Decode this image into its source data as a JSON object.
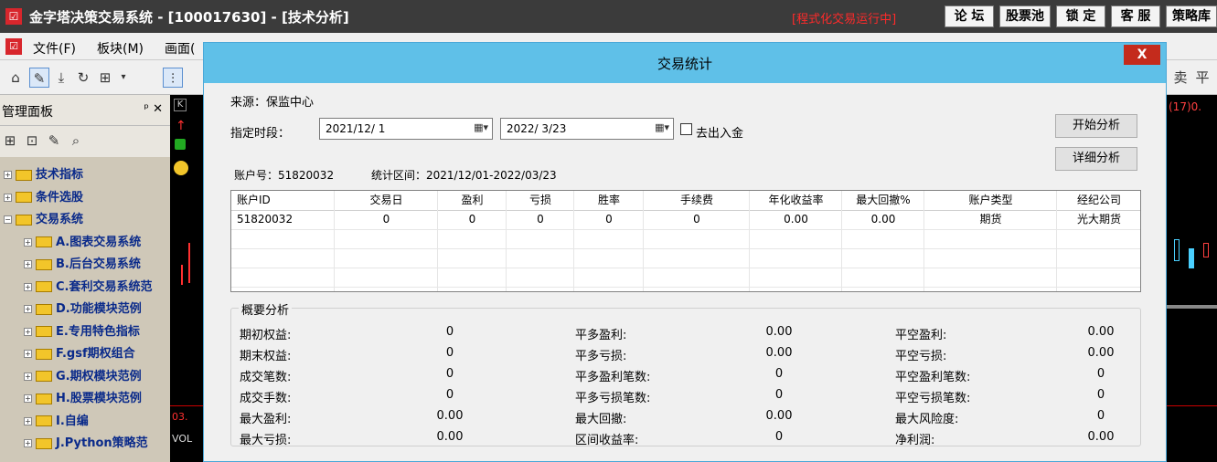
{
  "app": {
    "title": "金字塔决策交易系统 - [100017630] - [技术分析]",
    "run_status": "[程式化交易运行中]",
    "top_buttons": [
      "论 坛",
      "股票池",
      "锁 定",
      "客 服",
      "策略库"
    ]
  },
  "menu": {
    "items": [
      "文件(F)",
      "板块(M)",
      "画面("
    ]
  },
  "right_strip": {
    "labels": [
      "卖",
      "平"
    ],
    "value_text": "(17)0."
  },
  "chart_strip": {
    "label_k": "K",
    "label_date": "03.",
    "label_vol": "VOL"
  },
  "panel": {
    "title": "管理面板",
    "pin": "ᵖ ✕",
    "tree": [
      {
        "label": "技术指标",
        "level": 0,
        "expanded": false
      },
      {
        "label": "条件选股",
        "level": 0,
        "expanded": false
      },
      {
        "label": "交易系统",
        "level": 0,
        "expanded": true
      },
      {
        "label": "A.图表交易系统",
        "level": 1,
        "expanded": false
      },
      {
        "label": "B.后台交易系统",
        "level": 1,
        "expanded": false
      },
      {
        "label": "C.套利交易系统范",
        "level": 1,
        "expanded": false
      },
      {
        "label": "D.功能模块范例",
        "level": 1,
        "expanded": false
      },
      {
        "label": "E.专用特色指标",
        "level": 1,
        "expanded": false
      },
      {
        "label": "F.gsf期权组合",
        "level": 1,
        "expanded": false
      },
      {
        "label": "G.期权模块范例",
        "level": 1,
        "expanded": false
      },
      {
        "label": "H.股票模块范例",
        "level": 1,
        "expanded": false
      },
      {
        "label": "I.自编",
        "level": 1,
        "expanded": false
      },
      {
        "label": "J.Python策略范",
        "level": 1,
        "expanded": false
      }
    ]
  },
  "dialog": {
    "title": "交易统计",
    "close": "X",
    "source_label": "来源：保监中心",
    "period_label": "指定时段：",
    "start_date": "2021/12/ 1",
    "end_date": "2022/ 3/23",
    "exclude_label": "去出入金",
    "exclude_checked": false,
    "start_button": "开始分析",
    "detail_button": "详细分析",
    "account_label": "账户号：51820032",
    "range_label": "统计区间：2021/12/01-2022/03/23",
    "table": {
      "headers": [
        "账户ID",
        "交易日",
        "盈利",
        "亏损",
        "胜率",
        "手续费",
        "年化收益率",
        "最大回撤%",
        "账户类型",
        "经纪公司"
      ],
      "rows": [
        [
          "51820032",
          "0",
          "0",
          "0",
          "0",
          "0",
          "0.00",
          "0.00",
          "期货",
          "光大期货"
        ]
      ]
    },
    "summary": {
      "title": "概要分析",
      "col1": [
        {
          "label": "期初权益:",
          "value": "0"
        },
        {
          "label": "期末权益:",
          "value": "0"
        },
        {
          "label": "成交笔数:",
          "value": "0"
        },
        {
          "label": "成交手数:",
          "value": "0"
        },
        {
          "label": "最大盈利:",
          "value": "0.00"
        },
        {
          "label": "最大亏损:",
          "value": "0.00"
        }
      ],
      "col2": [
        {
          "label": "平多盈利:",
          "value": "0.00"
        },
        {
          "label": "平多亏损:",
          "value": "0.00"
        },
        {
          "label": "平多盈利笔数:",
          "value": "0"
        },
        {
          "label": "平多亏损笔数:",
          "value": "0"
        },
        {
          "label": "最大回撤:",
          "value": "0.00"
        },
        {
          "label": "区间收益率:",
          "value": "0"
        }
      ],
      "col3": [
        {
          "label": "平空盈利:",
          "value": "0.00"
        },
        {
          "label": "平空亏损:",
          "value": "0.00"
        },
        {
          "label": "平空盈利笔数:",
          "value": "0"
        },
        {
          "label": "平空亏损笔数:",
          "value": "0"
        },
        {
          "label": "最大风险度:",
          "value": "0"
        },
        {
          "label": "净利润:",
          "value": "0.00"
        }
      ]
    }
  }
}
